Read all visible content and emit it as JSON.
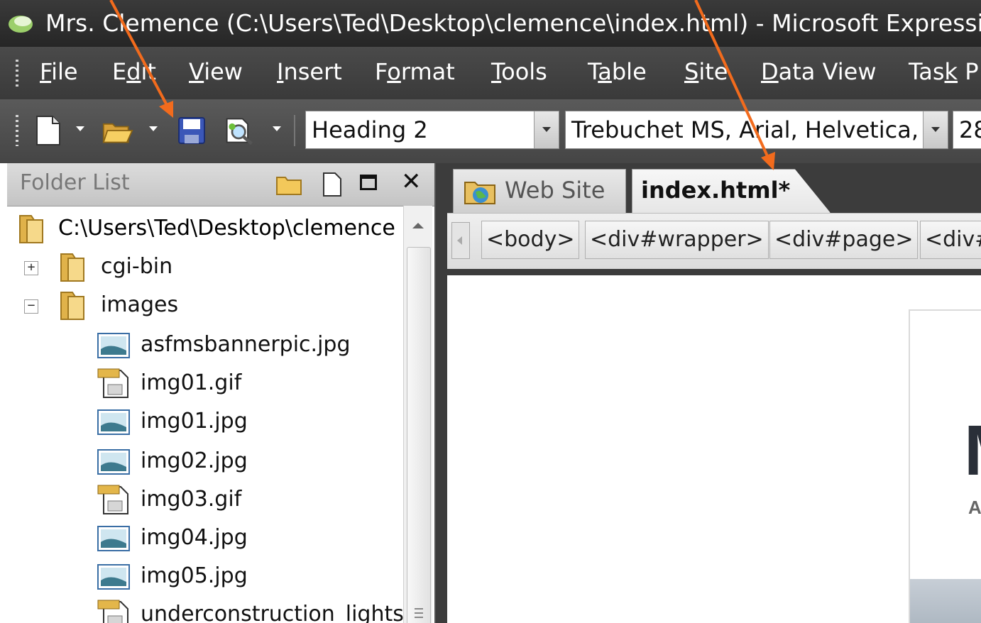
{
  "window": {
    "title": "Mrs. Clemence (C:\\Users\\Ted\\Desktop\\clemence\\index.html) - Microsoft Expressi"
  },
  "menu": {
    "items": [
      {
        "pre": "",
        "u": "F",
        "post": "ile"
      },
      {
        "pre": "E",
        "u": "d",
        "post": "it"
      },
      {
        "pre": "",
        "u": "V",
        "post": "iew"
      },
      {
        "pre": "",
        "u": "I",
        "post": "nsert"
      },
      {
        "pre": "F",
        "u": "o",
        "post": "rmat"
      },
      {
        "pre": "",
        "u": "T",
        "post": "ools"
      },
      {
        "pre": "T",
        "u": "a",
        "post": "ble"
      },
      {
        "pre": "",
        "u": "S",
        "post": "ite"
      },
      {
        "pre": "",
        "u": "D",
        "post": "ata View"
      },
      {
        "pre": "Tas",
        "u": "k",
        "post": " P"
      }
    ]
  },
  "toolbar": {
    "style_value": "Heading 2",
    "font_value": "Trebuchet MS, Arial, Helvetica,",
    "size_value": "28"
  },
  "folder_list": {
    "title": "Folder List",
    "root_path": "C:\\Users\\Ted\\Desktop\\clemence",
    "folders": [
      {
        "name": "cgi-bin",
        "expander": "+"
      },
      {
        "name": "images",
        "expander": "−"
      }
    ],
    "files": [
      {
        "name": "asfmsbannerpic.jpg",
        "kind": "jpg"
      },
      {
        "name": "img01.gif",
        "kind": "gif"
      },
      {
        "name": "img01.jpg",
        "kind": "jpg"
      },
      {
        "name": "img02.jpg",
        "kind": "jpg"
      },
      {
        "name": "img03.gif",
        "kind": "gif"
      },
      {
        "name": "img04.jpg",
        "kind": "jpg"
      },
      {
        "name": "img05.jpg",
        "kind": "jpg"
      },
      {
        "name": "underconstruction_lights",
        "kind": "gif"
      }
    ]
  },
  "tabs": {
    "website": "Web Site",
    "index": "index.html*"
  },
  "tag_selector": {
    "tags": [
      "<body>",
      "<div#wrapper>",
      "<div#page>",
      "<div#"
    ]
  },
  "preview": {
    "big_letter": "M",
    "small_letter": "A"
  },
  "colors": {
    "annotation_arrow": "#f26b1d",
    "dark_chrome": "#3a3a3a"
  },
  "icons": {
    "new_page": "new-page-icon",
    "open": "open-folder-icon",
    "save": "save-disk-icon",
    "preview": "preview-magnifier-icon"
  }
}
